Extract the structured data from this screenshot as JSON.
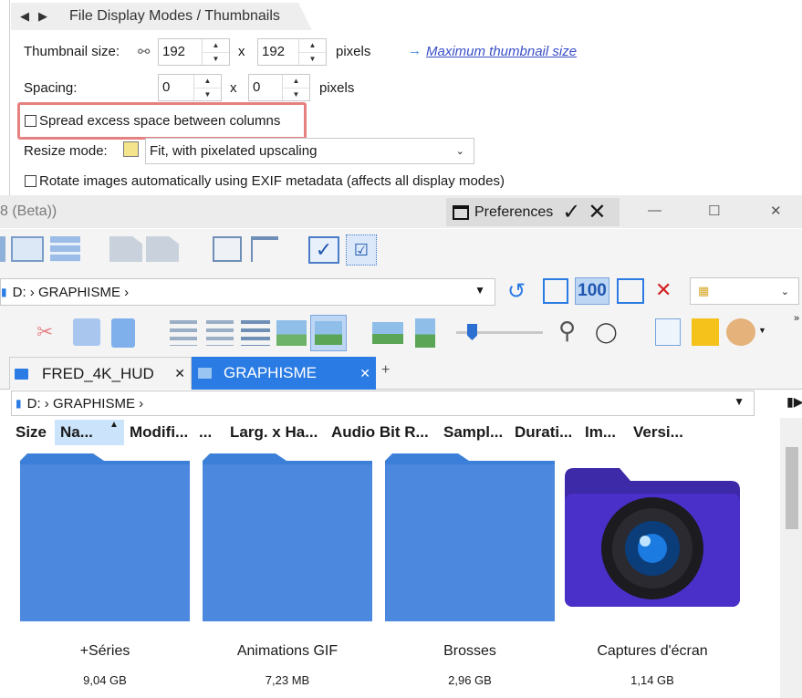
{
  "preferences_panel": {
    "breadcrumb": "File Display Modes / Thumbnails",
    "thumbnail_size_label": "Thumbnail size:",
    "thumb_width": "192",
    "thumb_height": "192",
    "times": "x",
    "pixels": "pixels",
    "max_link": "Maximum thumbnail size",
    "spacing_label": "Spacing:",
    "spacing_x": "0",
    "spacing_y": "0",
    "spread_label": "Spread excess space between columns",
    "resize_label": "Resize mode:",
    "resize_value": "Fit, with pixelated upscaling",
    "rotate_label": "Rotate images automatically using EXIF metadata (affects all display modes)"
  },
  "titlebar": {
    "app_title": "8 (Beta))",
    "preferences_label": "Preferences"
  },
  "toolbar": {
    "zoom_100": "100"
  },
  "address_top": {
    "path": "D: › GRAPHISME ›"
  },
  "tabs": [
    {
      "label": "FRED_4K_HUD"
    },
    {
      "label": "GRAPHISME"
    }
  ],
  "address_tab": {
    "path": "D: › GRAPHISME ›"
  },
  "columns": [
    "Size",
    "Na...",
    "Modifi...",
    "...",
    "Larg. x Ha...",
    "Audio Bit R...",
    "Sampl...",
    "Durati...",
    "Im...",
    "Versi..."
  ],
  "items": [
    {
      "name": "+Séries",
      "size": "9,04 GB"
    },
    {
      "name": "Animations GIF",
      "size": "7,23 MB"
    },
    {
      "name": "Brosses",
      "size": "2,96 GB"
    },
    {
      "name": "Captures d'écran",
      "size": "1,14 GB"
    }
  ],
  "colors": {
    "folder": "#4b88de",
    "active_tab": "#2b7be4",
    "highlight": "#e68080",
    "link": "#3a4fc8"
  }
}
